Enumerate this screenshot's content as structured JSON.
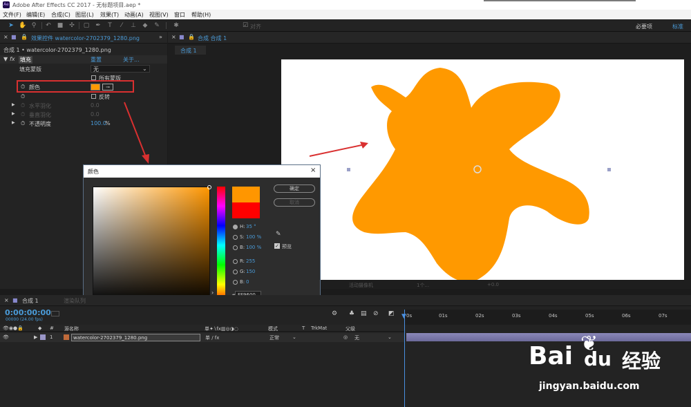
{
  "titlebar": {
    "title": "Adobe After Effects CC 2017 - 无标题项目.aep *",
    "logo": "Ae"
  },
  "menubar": [
    "文件(F)",
    "编辑(E)",
    "合成(C)",
    "图层(L)",
    "效果(T)",
    "动画(A)",
    "视图(V)",
    "窗口",
    "帮助(H)"
  ],
  "toolbar": {
    "snap_label": "对齐",
    "workspace_1": "必要项",
    "workspace_2": "标准"
  },
  "effects_panel": {
    "tab_title": "效果控件 watercolor-2702379_1280.png",
    "breadcrumb": "合成 1 • watercolor-2702379_1280.png",
    "effect_name": "填充",
    "reset": "重置",
    "about": "关于...",
    "fill_mask_label": "填充蒙版",
    "fill_mask_value": "无",
    "all_masks": "所有蒙版",
    "color_label": "颜色",
    "invert_label": "反转",
    "h_feather": "水平羽化",
    "h_feather_value": "0.0",
    "v_feather": "垂直羽化",
    "v_feather_value": "0.0",
    "opacity_label": "不透明度",
    "opacity_value": "100.0",
    "opacity_unit": "%"
  },
  "viewer": {
    "tab": "合成 合成 1",
    "subtab": "合成 1",
    "camera": "活动摄像机",
    "view_count": "1个...",
    "exposure": "+0.0"
  },
  "color_dialog": {
    "title": "颜色",
    "ok": "确定",
    "cancel": "取消",
    "h_label": "H:",
    "h_value": "35 °",
    "s_label": "S:",
    "s_value": "100 %",
    "b_label": "B:",
    "b_value": "100 %",
    "r_label": "R:",
    "r_value": "255",
    "g_label": "G:",
    "g_value": "150",
    "bb_label": "B:",
    "bb_value": "0",
    "hex_label": "#",
    "hex_value": "FF9600",
    "preview_label": "预览",
    "new_color": "#ff9600",
    "old_color": "#ff0000"
  },
  "timeline": {
    "tab": "合成 1",
    "tab2": "渲染队列",
    "timecode": "0:00:00:00",
    "fps": "00000 (24.00 fps)",
    "col_hash": "#",
    "col_source": "源名称",
    "col_mode": "模式",
    "col_t": "T",
    "col_trkmat": "TrkMat",
    "col_parent": "父级",
    "layer_num": "1",
    "layer_name": "watercolor-2702379_1280.png",
    "layer_mode": "正常",
    "layer_parent": "无",
    "ruler": [
      "0s",
      "01s",
      "02s",
      "03s",
      "04s",
      "05s",
      "06s",
      "07s"
    ]
  },
  "watermark": {
    "brand": "Bai",
    "brand2": "du",
    "brand_cn": "经验",
    "url": "jingyan.baidu.com"
  },
  "colors": {
    "accent": "#4a9bd8",
    "fill": "#ff9900",
    "highlight_box": "#d93030"
  }
}
